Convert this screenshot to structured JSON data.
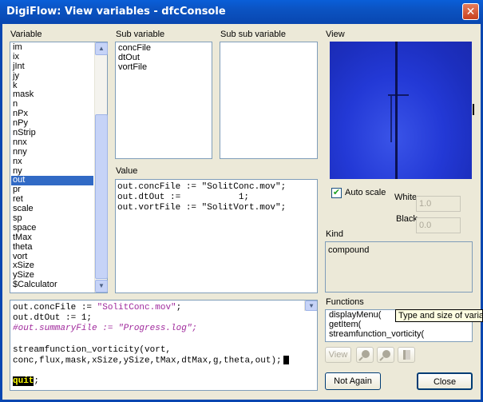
{
  "window": {
    "title": "DigiFlow: View variables - dfcConsole",
    "close_glyph": "✕"
  },
  "variable_panel": {
    "label": "Variable",
    "items": [
      "im",
      "ix",
      "jInt",
      "jy",
      "k",
      "mask",
      "n",
      "nPx",
      "nPy",
      "nStrip",
      "nnx",
      "nny",
      "nx",
      "ny",
      "out",
      "pr",
      "ret",
      "scale",
      "sp",
      "space",
      "tMax",
      "theta",
      "vort",
      "xSize",
      "ySize",
      "$Calculator"
    ],
    "selected": "out"
  },
  "sub_variable_panel": {
    "label": "Sub variable",
    "items": [
      "concFile",
      "dtOut",
      "vortFile"
    ]
  },
  "sub_sub_variable_panel": {
    "label": "Sub sub variable",
    "items": []
  },
  "value_panel": {
    "label": "Value",
    "lines": [
      "out.concFile := \"SolitConc.mov\";",
      "out.dtOut :=           1;",
      "out.vortFile := \"SolitVort.mov\";"
    ]
  },
  "view_panel": {
    "label": "View",
    "accent_color": "#2339d6"
  },
  "scale": {
    "auto_scale_label": "Auto scale",
    "auto_scale_checked": true,
    "white_label": "White",
    "white_value": "1.0",
    "black_label": "Black",
    "black_value": "0.0"
  },
  "kind_panel": {
    "label": "Kind",
    "value": "compound"
  },
  "functions_panel": {
    "label": "Functions",
    "items": [
      "displayMenu(",
      "getItem(",
      "streamfunction_vorticity("
    ],
    "tooltip": "Type and size of variable",
    "view_button": "View"
  },
  "editor": {
    "lines": [
      {
        "prefix": "out.concFile := ",
        "str": "\"SolitConc.mov\"",
        "suffix": ";"
      },
      {
        "prefix": "out.dtOut := 1;",
        "str": "",
        "suffix": ""
      },
      {
        "prefix": "",
        "str": "#out.summaryFile := \"Progress.log\";",
        "suffix": ""
      },
      {
        "prefix": "",
        "str": "",
        "suffix": ""
      },
      {
        "prefix": "streamfunction_vorticity(vort,",
        "str": "",
        "suffix": ""
      },
      {
        "prefix": "conc,flux,mask,xSize,ySize,tMax,dtMax,g,theta,out);",
        "str": "",
        "suffix": ""
      },
      {
        "prefix": "",
        "str": "",
        "suffix": ""
      },
      {
        "prefix": "quit",
        "str": "",
        "suffix": ";"
      }
    ]
  },
  "buttons": {
    "not_again": "Not Again",
    "close": "Close"
  }
}
